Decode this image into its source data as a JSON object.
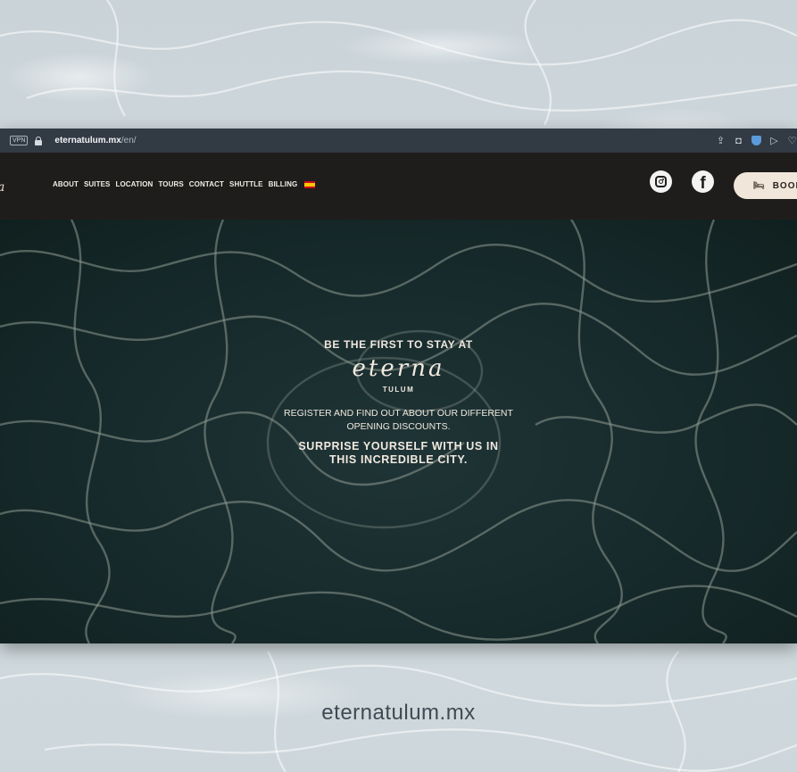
{
  "browser": {
    "vpn_badge": "VPN",
    "url_domain": "eternatulum.mx",
    "url_path": "/en/",
    "icons": [
      "share-icon",
      "camera-icon",
      "shield-icon",
      "send-icon",
      "heart-icon"
    ]
  },
  "header": {
    "logo_fragment": "a",
    "nav": [
      {
        "label": "ABOUT"
      },
      {
        "label": "SUITES"
      },
      {
        "label": "LOCATION"
      },
      {
        "label": "TOURS"
      },
      {
        "label": "CONTACT"
      },
      {
        "label": "SHUTTLE"
      },
      {
        "label": "BILLING"
      }
    ],
    "language_flag": "spain-flag-icon",
    "book_label": "BOOK"
  },
  "hero": {
    "tagline": "BE THE FIRST TO STAY AT",
    "brand_name": "eterna",
    "brand_sub": "TULUM",
    "register_line1": "REGISTER AND FIND OUT ABOUT OUR DIFFERENT",
    "register_line2": "OPENING DISCOUNTS.",
    "surprise_line1": "SURPRISE YOURSELF WITH US IN",
    "surprise_line2": "THIS INCREDIBLE CITY."
  },
  "caption": "eternatulum.mx",
  "colors": {
    "header_bg": "#1f1d1b",
    "hero_bg": "#172a2b",
    "book_button": "#f1e6da",
    "hero_text": "#f1e9df"
  }
}
